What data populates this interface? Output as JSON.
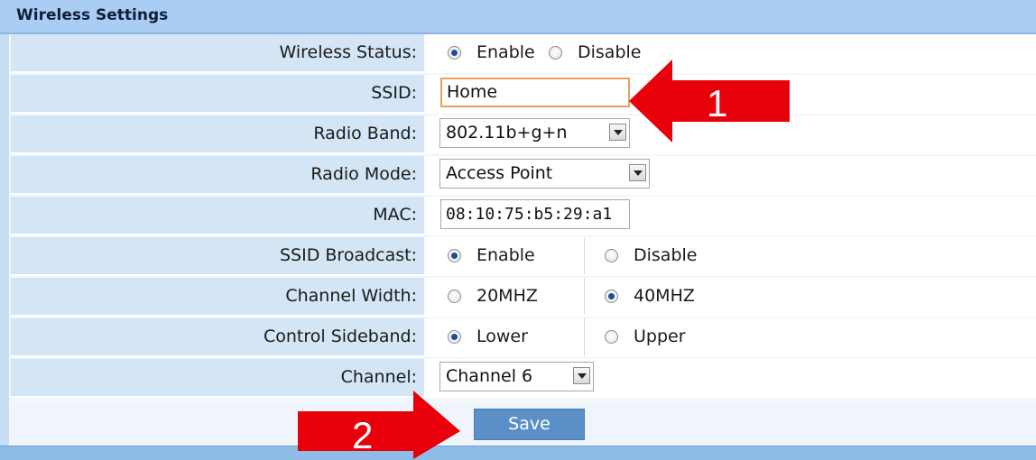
{
  "panel": {
    "title": "Wireless Settings"
  },
  "rows": {
    "wireless_status": {
      "label": "Wireless Status:",
      "options": [
        "Enable",
        "Disable"
      ],
      "selected": "Enable"
    },
    "ssid": {
      "label": "SSID:",
      "value": "Home"
    },
    "radio_band": {
      "label": "Radio Band:",
      "value": "802.11b+g+n"
    },
    "radio_mode": {
      "label": "Radio Mode:",
      "value": "Access Point"
    },
    "mac": {
      "label": "MAC:",
      "value": "08:10:75:b5:29:a1"
    },
    "ssid_broadcast": {
      "label": "SSID Broadcast:",
      "options": [
        "Enable",
        "Disable"
      ],
      "selected": "Enable"
    },
    "channel_width": {
      "label": "Channel Width:",
      "options": [
        "20MHZ",
        "40MHZ"
      ],
      "selected": "40MHZ"
    },
    "control_sideband": {
      "label": "Control Sideband:",
      "options": [
        "Lower",
        "Upper"
      ],
      "selected": "Lower"
    },
    "channel": {
      "label": "Channel:",
      "value": "Channel 6"
    }
  },
  "save_label": "Save",
  "annotations": {
    "arrow_1": "1",
    "arrow_2": "2",
    "color": "#e8000b"
  },
  "colors": {
    "title_bar": "#a9cdf3",
    "label_cell": "#d4e5f5",
    "button": "#5b8fc8",
    "focus_border": "#e9a15a"
  }
}
